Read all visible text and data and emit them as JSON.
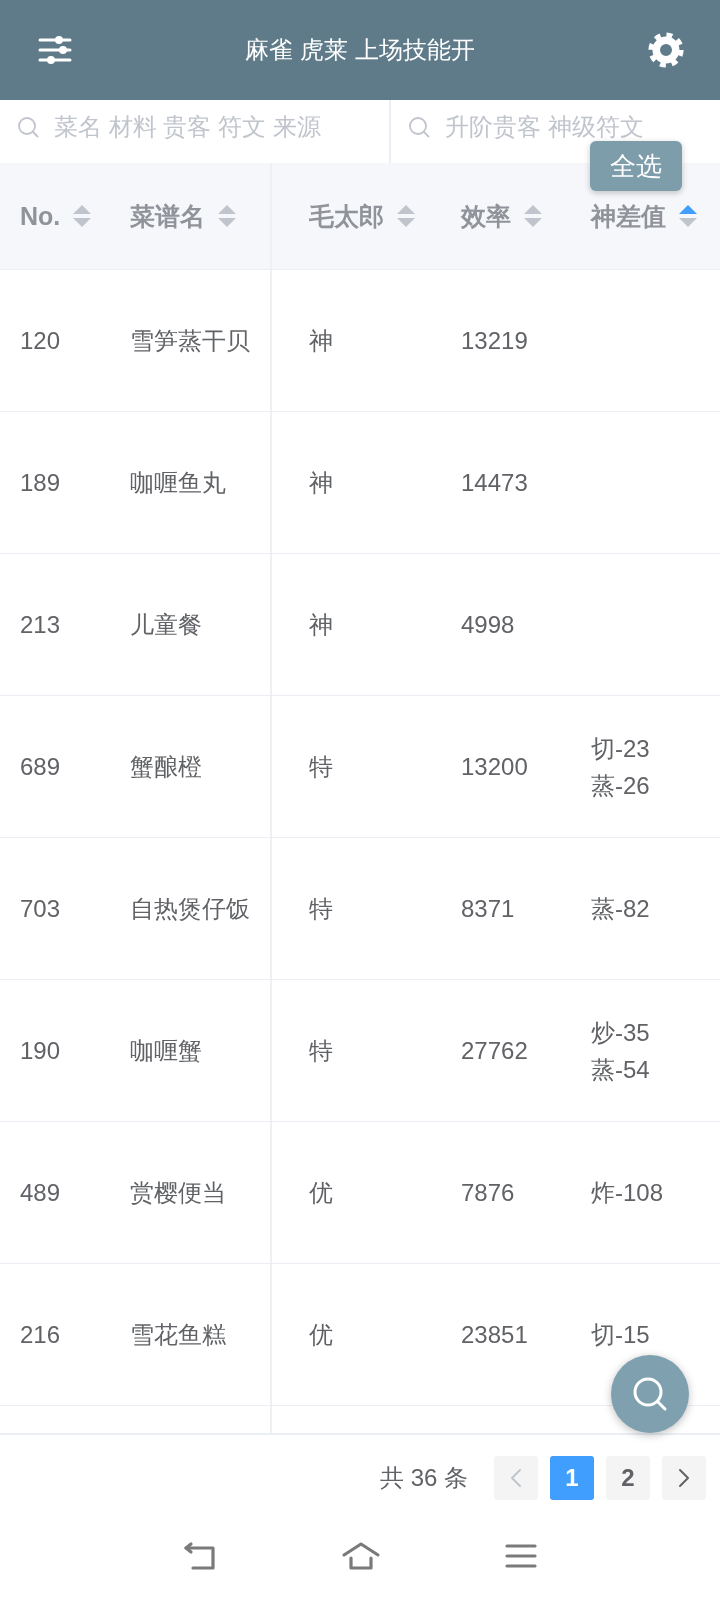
{
  "top_bar": {
    "title": "麻雀 虎莱 上场技能开"
  },
  "search": [
    {
      "placeholder": "菜名 材料 贵客 符文 来源"
    },
    {
      "placeholder": "升阶贵客 神级符文"
    }
  ],
  "select_all_button": {
    "label": "全选"
  },
  "table": {
    "columns": [
      {
        "label": "No.",
        "sort_ascending": false
      },
      {
        "label": "菜谱名",
        "sort_ascending": false
      },
      {
        "label": "毛太郎",
        "sort_ascending": false
      },
      {
        "label": "效率",
        "sort_ascending": false
      },
      {
        "label": "神差值",
        "sort_ascending": true
      }
    ],
    "rows": [
      {
        "no": "120",
        "name": "雪笋蒸干贝",
        "grade": "神",
        "efficiency": "13219"
      },
      {
        "no": "189",
        "name": "咖喱鱼丸",
        "grade": "神",
        "efficiency": "14473"
      },
      {
        "no": "213",
        "name": "儿童餐",
        "grade": "神",
        "efficiency": "4998"
      },
      {
        "no": "689",
        "name": "蟹酿橙",
        "grade": "特",
        "efficiency": "13200",
        "god_diff": [
          "切-23",
          "蒸-26"
        ]
      },
      {
        "no": "703",
        "name": "自热煲仔饭",
        "grade": "特",
        "efficiency": "8371",
        "god_diff": [
          "蒸-82"
        ]
      },
      {
        "no": "190",
        "name": "咖喱蟹",
        "grade": "特",
        "efficiency": "27762",
        "god_diff": [
          "炒-35",
          "蒸-54"
        ]
      },
      {
        "no": "489",
        "name": "赏樱便当",
        "grade": "优",
        "efficiency": "7876",
        "god_diff": [
          "炸-108"
        ]
      },
      {
        "no": "216",
        "name": "雪花鱼糕",
        "grade": "优",
        "efficiency": "23851",
        "god_diff": [
          "切-15"
        ]
      }
    ]
  },
  "pagination": {
    "total": "共 36 条",
    "prev_button": {
      "disabled": true
    },
    "pages": [
      {
        "label": "1",
        "selected": true
      },
      {
        "label": "2",
        "selected": false
      }
    ],
    "next_button": {
      "disabled": false
    }
  }
}
